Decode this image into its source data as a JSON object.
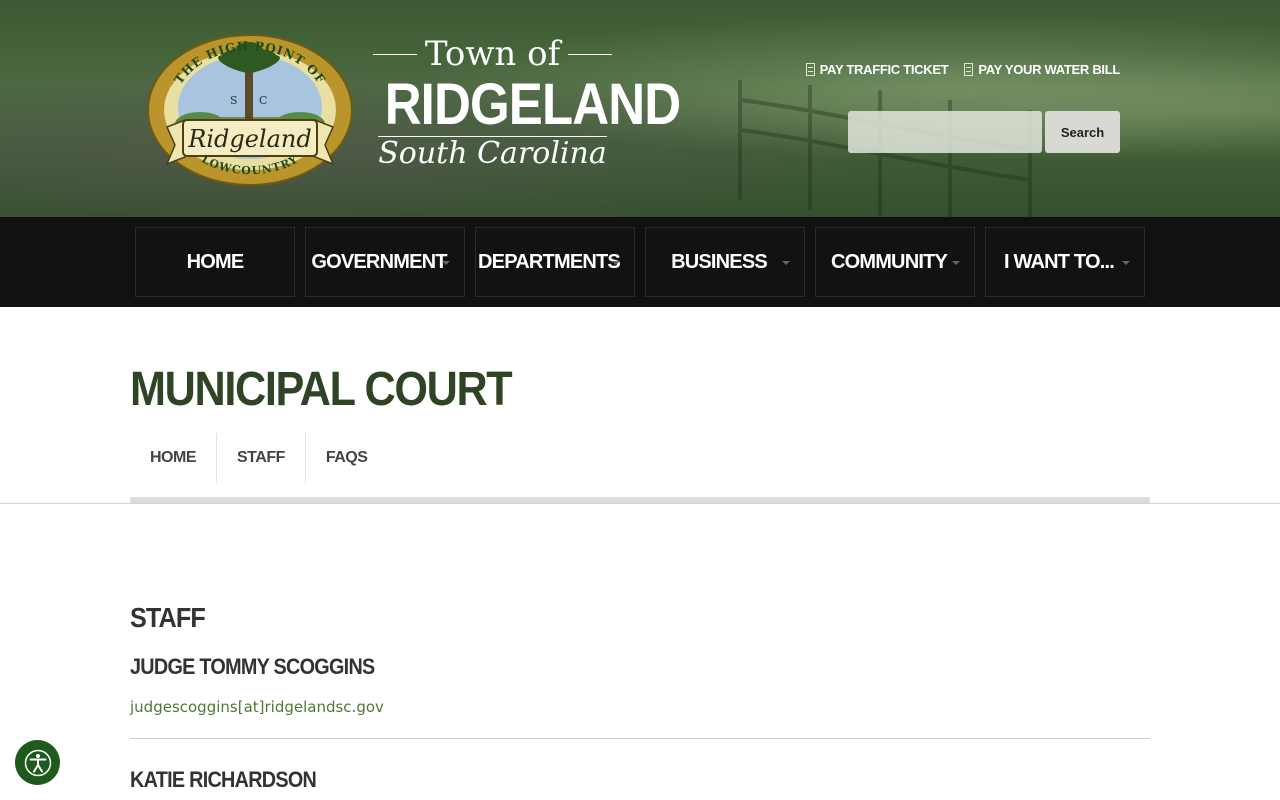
{
  "header": {
    "seal": {
      "top_arc": "THE HIGH POINT OF",
      "state": "SC",
      "banner": "Ridgeland",
      "bottom_arc": "LOWCOUNTRY"
    },
    "wordmark": {
      "town_of": "Town of",
      "name": "RIDGELAND",
      "state": "South Carolina"
    },
    "quick_links": [
      {
        "label": "PAY TRAFFIC TICKET",
        "icon": "document-icon"
      },
      {
        "label": "PAY YOUR WATER BILL",
        "icon": "document-icon"
      }
    ],
    "search": {
      "placeholder": "",
      "button_label": "Search"
    }
  },
  "nav": {
    "items": [
      {
        "label": "HOME",
        "has_dropdown": false
      },
      {
        "label": "GOVERNMENT",
        "has_dropdown": true
      },
      {
        "label": "DEPARTMENTS",
        "has_dropdown": true
      },
      {
        "label": "BUSINESS",
        "has_dropdown": true
      },
      {
        "label": "COMMUNITY",
        "has_dropdown": true
      },
      {
        "label": "I WANT TO...",
        "has_dropdown": true
      }
    ]
  },
  "page": {
    "title": "MUNICIPAL COURT",
    "subnav": [
      "HOME",
      "STAFF",
      "FAQS"
    ],
    "section_heading": "STAFF",
    "staff": [
      {
        "name": "JUDGE TOMMY SCOGGINS",
        "email": "judgescoggins[at]ridgelandsc.gov"
      },
      {
        "name": "KATIE RICHARDSON"
      }
    ]
  },
  "accessibility": {
    "icon": "accessibility-icon"
  },
  "colors": {
    "header_green": "#3d5a34",
    "nav_black": "#111111",
    "title_green": "#2e4424",
    "link_green": "#4d7a32",
    "accessibility_green": "#1e5a1e"
  }
}
